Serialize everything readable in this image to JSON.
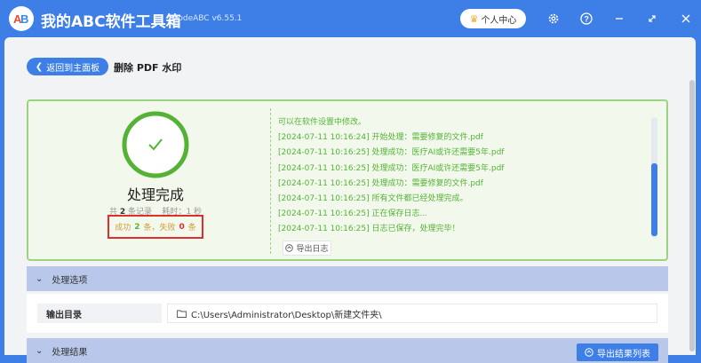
{
  "app": {
    "title": "我的ABC软件工具箱",
    "version": "WodeABC v6.55.1",
    "user_center": "个人中心",
    "accent": "#3d7fe6"
  },
  "toolbar": {
    "back_label": "返回到主面板",
    "page_title": "删除 PDF 水印"
  },
  "result": {
    "status": "处理完成",
    "total_prefix": "共",
    "total_count": "2",
    "total_suffix": "条记录",
    "time_label": "耗时：1 秒",
    "success_label": "成功",
    "success_count": "2",
    "success_unit": "条，失败",
    "fail_count": "0",
    "fail_unit": "条"
  },
  "log": {
    "lines": [
      "可以在软件设置中修改。",
      "[2024-07-11 10:16:24] 开始处理：需要修复的文件.pdf",
      "[2024-07-11 10:16:25] 处理成功：医疗AI或许还需要5年.pdf",
      "[2024-07-11 10:16:25] 处理成功：医疗AI或许还需要5年.pdf",
      "[2024-07-11 10:16:25] 处理成功：需要修复的文件.pdf",
      "[2024-07-11 10:16:25] 所有文件都已经处理完成。",
      "[2024-07-11 10:16:25] 正在保存日志...",
      "[2024-07-11 10:16:25] 日志已保存，处理完毕！"
    ],
    "export_label": "导出日志"
  },
  "options": {
    "header": "处理选项",
    "output_label": "输出目录",
    "output_path": "C:\\Users\\Administrator\\Desktop\\新建文件夹\\"
  },
  "results_section": {
    "header": "处理结果",
    "export_list_label": "导出结果列表"
  }
}
